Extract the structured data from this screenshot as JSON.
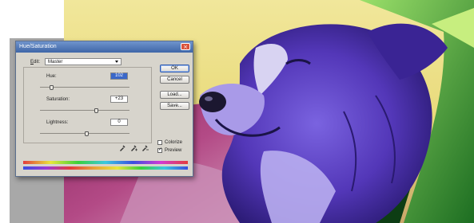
{
  "dialog": {
    "title": "Hue/Saturation",
    "edit_label_underlined": "E",
    "edit_label_rest": "dit:",
    "edit_value": "Master",
    "hue_label": "Hue:",
    "hue_value": "102",
    "saturation_label": "Saturation:",
    "saturation_value": "+23",
    "lightness_label": "Lightness:",
    "lightness_value": "0",
    "buttons": {
      "ok": "OK",
      "cancel": "Cancel",
      "load": "Load...",
      "save": "Save..."
    },
    "colorize_label": "Colorize",
    "preview_label": "Preview",
    "preview_checked": true,
    "colorize_checked": false,
    "icons": [
      "eyedropper-icon",
      "eyedropper-plus-icon",
      "eyedropper-minus-icon"
    ]
  },
  "colors": {
    "titlebar": "#4a6fb0",
    "dialog_bg": "#d7d4cc",
    "dog_fur": "#5b3fc4",
    "sky": "#ece38a"
  }
}
